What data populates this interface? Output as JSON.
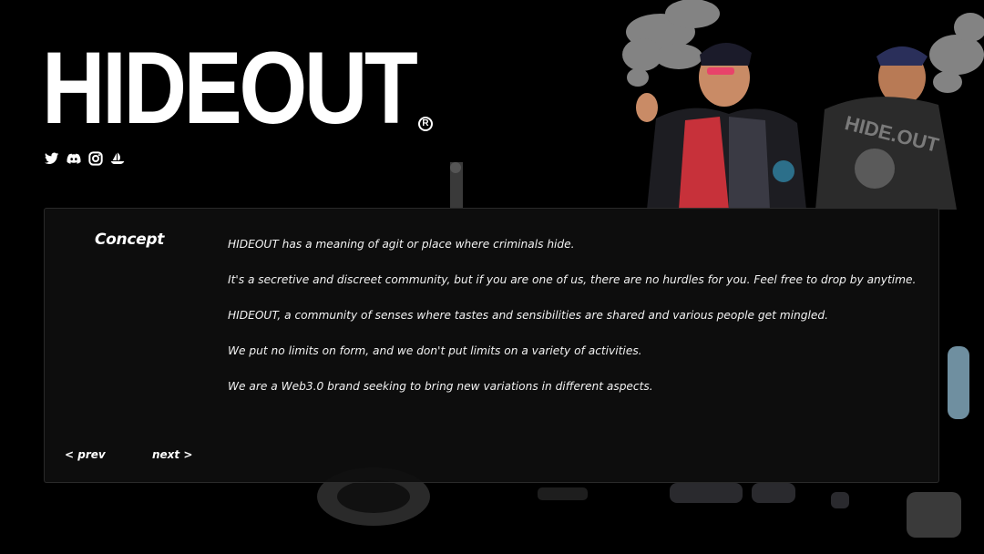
{
  "brand": {
    "logo_text": "HIDEOUT",
    "registered_mark": "R"
  },
  "socials": [
    {
      "name": "twitter",
      "icon": "twitter-icon"
    },
    {
      "name": "discord",
      "icon": "discord-icon"
    },
    {
      "name": "instagram",
      "icon": "instagram-icon"
    },
    {
      "name": "opensea",
      "icon": "opensea-icon"
    }
  ],
  "concept": {
    "title": "Concept",
    "paragraphs": [
      "HIDEOUT has a meaning of agit or place where criminals hide.",
      "It's a secretive and discreet community, but if you are one of us, there are no hurdles for you. Feel free to drop by anytime.",
      "HIDEOUT, a community of senses where tastes and sensibilities are shared and various people get mingled.",
      "We put no limits on form, and we don't put limits on a variety of activities.",
      "We are a Web3.0 brand seeking to bring new variations in different aspects."
    ],
    "prev_label": "< prev",
    "next_label": "next >"
  },
  "colors": {
    "background": "#000000",
    "panel": "#0e0e0e",
    "text": "#ffffff"
  }
}
